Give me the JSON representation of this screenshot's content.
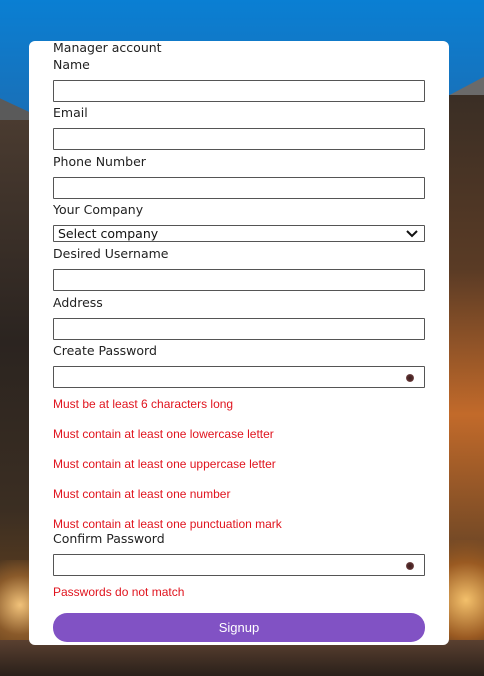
{
  "form": {
    "title": "Manager account",
    "name_label": "Name",
    "email_label": "Email",
    "phone_label": "Phone Number",
    "company_label": "Your Company",
    "company_selected": "Select company",
    "username_label": "Desired Username",
    "address_label": "Address",
    "password_label": "Create Password",
    "password_errors": [
      "Must be at least 6 characters long",
      "Must contain at least one lowercase letter",
      "Must contain at least one uppercase letter",
      "Must contain at least one number",
      "Must contain at least one punctuation mark"
    ],
    "confirm_label": "Confirm Password",
    "confirm_error": "Passwords do not match",
    "submit_label": "Signup"
  },
  "colors": {
    "error": "#e0141e",
    "button": "#8152c4"
  }
}
